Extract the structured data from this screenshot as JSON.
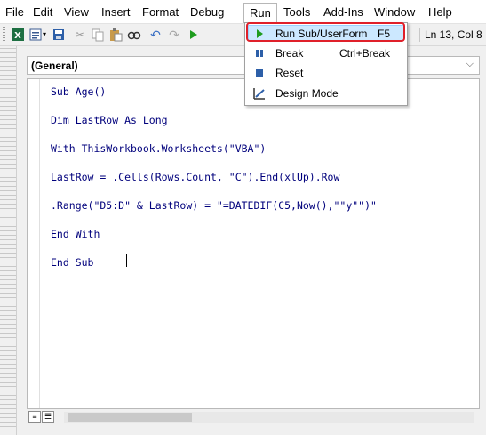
{
  "menu": {
    "file": "File",
    "edit": "Edit",
    "view": "View",
    "insert": "Insert",
    "format": "Format",
    "debug": "Debug",
    "run": "Run",
    "tools": "Tools",
    "addins": "Add-Ins",
    "window": "Window",
    "help": "Help"
  },
  "toolbar": {
    "position": "Ln 13, Col 8"
  },
  "code_window": {
    "object_combo": "(General)",
    "lines": [
      "Sub Age()",
      "Dim LastRow As Long",
      "With ThisWorkbook.Worksheets(\"VBA\")",
      "LastRow = .Cells(Rows.Count, \"C\").End(xlUp).Row",
      ".Range(\"D5:D\" & LastRow) = \"=DATEDIF(C5,Now(),\"\"y\"\")\"",
      "End With",
      "End Sub"
    ]
  },
  "run_menu": {
    "items": [
      {
        "label": "Run Sub/UserForm",
        "shortcut": "F5",
        "icon": "run-icon"
      },
      {
        "label": "Break",
        "shortcut": "Ctrl+Break",
        "icon": "break-icon"
      },
      {
        "label": "Reset",
        "shortcut": "",
        "icon": "reset-icon"
      },
      {
        "label": "Design Mode",
        "shortcut": "",
        "icon": "design-mode-icon"
      }
    ]
  },
  "colors": {
    "code_text": "#00007c",
    "highlight": "#e0202a",
    "run_green": "#1e9c1e"
  }
}
